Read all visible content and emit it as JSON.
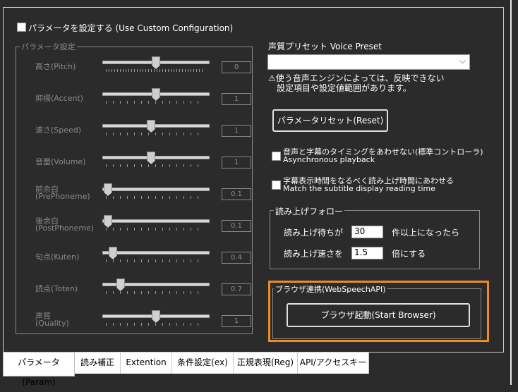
{
  "custom_config_label": "パラメータを設定する (Use Custom Configuration)",
  "param_group": {
    "title": "パラメータ設定",
    "rows": [
      {
        "label": "高さ(Pitch)",
        "value": "0",
        "fraction": 0.5
      },
      {
        "label": "抑揚(Accent)",
        "value": "1",
        "fraction": 0.5
      },
      {
        "label": "速さ(Speed)",
        "value": "1",
        "fraction": 0.45
      },
      {
        "label": "音量(Volume)",
        "value": "1",
        "fraction": 0.45
      },
      {
        "label": "前余白",
        "label2": "(PrePhoneme)",
        "value": "0.1",
        "fraction": 0.0
      },
      {
        "label": "後余白",
        "label2": "(PostPhoneme)",
        "value": "0.1",
        "fraction": 0.0
      },
      {
        "label": "句点(Kuten)",
        "value": "0.4",
        "fraction": 0.05
      },
      {
        "label": "読点(Toten)",
        "value": "0.7",
        "fraction": 0.13
      },
      {
        "label": "声質",
        "label2": "(Quality)",
        "value": "1",
        "fraction": 0.5
      }
    ]
  },
  "voice_preset": {
    "label": "声質プリセット  Voice Preset",
    "selected": "",
    "warning_line1": "⚠使う音声エンジンによっては、反映できない",
    "warning_line2": "設定項目や設定値範囲があります。"
  },
  "reset_button": "パラメータリセット(Reset)",
  "async_option": {
    "line1": "音声と字幕のタイミングをあわせない(標準コントローラ)",
    "line2": "Asynchronous playback"
  },
  "subtitle_option": {
    "line1": "字幕表示時間をなるべく読み上げ時間にあわせる",
    "line2": "Match the subtitle display reading time"
  },
  "follow_group": {
    "title": "読み上げフォロー",
    "wait_label": "読み上げ待ちが",
    "wait_value": "30",
    "wait_suffix": "件以上になったら",
    "speed_label": "読み上げ速さを",
    "speed_value": "1.5",
    "speed_suffix": "倍にする"
  },
  "browser_group": {
    "title": "ブラウザ連携(WebSpeechAPI)",
    "button": "ブラウザ起動(Start Browser)",
    "highlight_color": "#f08a24"
  },
  "tabs": [
    {
      "label": "パラメータ(Param)",
      "active": true
    },
    {
      "label": "読み補正"
    },
    {
      "label": "Extention"
    },
    {
      "label": "条件設定(ex)"
    },
    {
      "label": "正規表現(Reg)"
    },
    {
      "label": "API/アクセスキー"
    }
  ]
}
